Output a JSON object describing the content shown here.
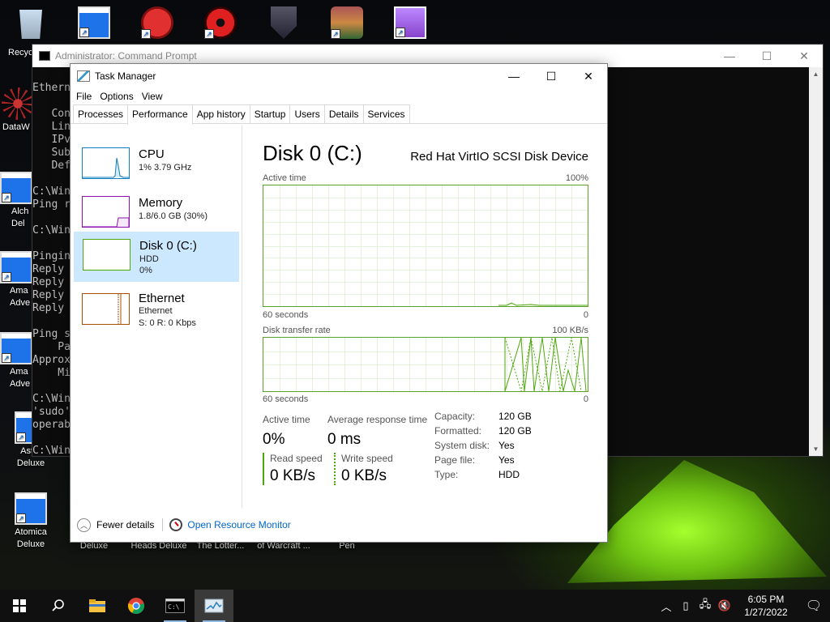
{
  "desktop": {
    "icons": [
      {
        "label": "Recyc",
        "icon": "recycle-bin-icon"
      },
      {
        "label": "",
        "icon": "app-icon"
      },
      {
        "label": "",
        "icon": "red-creature-icon"
      },
      {
        "label": "",
        "icon": "radiation-icon"
      },
      {
        "label": "",
        "icon": "shield-icon"
      },
      {
        "label": "",
        "icon": "character-icon"
      },
      {
        "label": "",
        "icon": "cocktail-icon"
      },
      {
        "label": "DataW",
        "icon": "spider-icon"
      },
      {
        "label": "Alch\nDel",
        "icon": "app-icon"
      },
      {
        "label": "Ama\nAdve",
        "icon": "app-icon"
      },
      {
        "label": "Ama\nAdve",
        "icon": "app-icon"
      },
      {
        "label": "Astro\nDeluxe",
        "icon": "app-icon"
      },
      {
        "label": "Atomica\nDeluxe",
        "icon": "app-icon"
      },
      {
        "label": "Deluxe",
        "icon": "app-icon"
      },
      {
        "label": "Heads Deluxe",
        "icon": "app-icon"
      },
      {
        "label": "The Lotter...",
        "icon": "app-icon"
      },
      {
        "label": "of Warcraft ...",
        "icon": "app-icon"
      },
      {
        "label": "Pen",
        "icon": "app-icon"
      }
    ]
  },
  "cmd": {
    "title": "Administrator: Command Prompt",
    "lines": [
      "Ethern",
      "",
      "   Con",
      "   Lin",
      "   IPv",
      "   Sub",
      "   Def",
      "",
      "C:\\Win",
      "Ping r",
      "",
      "C:\\Win",
      "",
      "Pingin",
      "Reply",
      "Reply",
      "Reply",
      "Reply",
      "",
      "Ping s",
      "    Pa",
      "Approx",
      "    Mi",
      "",
      "C:\\Win",
      "'sudo'",
      "operab",
      "",
      "C:\\Win"
    ]
  },
  "taskmanager": {
    "title": "Task Manager",
    "menu": [
      "File",
      "Options",
      "View"
    ],
    "tabs": [
      "Processes",
      "Performance",
      "App history",
      "Startup",
      "Users",
      "Details",
      "Services"
    ],
    "active_tab": "Performance",
    "resources": [
      {
        "name": "CPU",
        "line2": "1% 3.79 GHz",
        "line3": "",
        "color": "#117dbb"
      },
      {
        "name": "Memory",
        "line2": "1.8/6.0 GB (30%)",
        "line3": "",
        "color": "#8b12ae"
      },
      {
        "name": "Disk 0 (C:)",
        "line2": "HDD",
        "line3": "0%",
        "color": "#4da60c"
      },
      {
        "name": "Ethernet",
        "line2": "Ethernet",
        "line3": "S: 0 R: 0 Kbps",
        "color": "#a74f01"
      }
    ],
    "selected_resource": "Disk 0 (C:)",
    "detail": {
      "title": "Disk 0 (C:)",
      "device": "Red Hat VirtIO SCSI Disk Device",
      "graph1": {
        "label": "Active time",
        "max": "100%",
        "xlabel": "60 seconds",
        "min": "0"
      },
      "graph2": {
        "label": "Disk transfer rate",
        "max": "100 KB/s",
        "xlabel": "60 seconds",
        "min": "0"
      },
      "stats": {
        "active_time_label": "Active time",
        "active_time": "0%",
        "avg_resp_label": "Average response time",
        "avg_resp": "0 ms",
        "read_label": "Read speed",
        "read": "0 KB/s",
        "write_label": "Write speed",
        "write": "0 KB/s"
      },
      "properties": [
        {
          "k": "Capacity:",
          "v": "120 GB"
        },
        {
          "k": "Formatted:",
          "v": "120 GB"
        },
        {
          "k": "System disk:",
          "v": "Yes"
        },
        {
          "k": "Page file:",
          "v": "Yes"
        },
        {
          "k": "Type:",
          "v": "HDD"
        }
      ]
    },
    "footer": {
      "fewer": "Fewer details",
      "resmon": "Open Resource Monitor"
    }
  },
  "taskbar": {
    "items": [
      "start-icon",
      "search-icon",
      "file-explorer-icon",
      "chrome-icon",
      "command-prompt-icon",
      "task-manager-icon"
    ],
    "time": "6:05 PM",
    "date": "1/27/2022"
  }
}
